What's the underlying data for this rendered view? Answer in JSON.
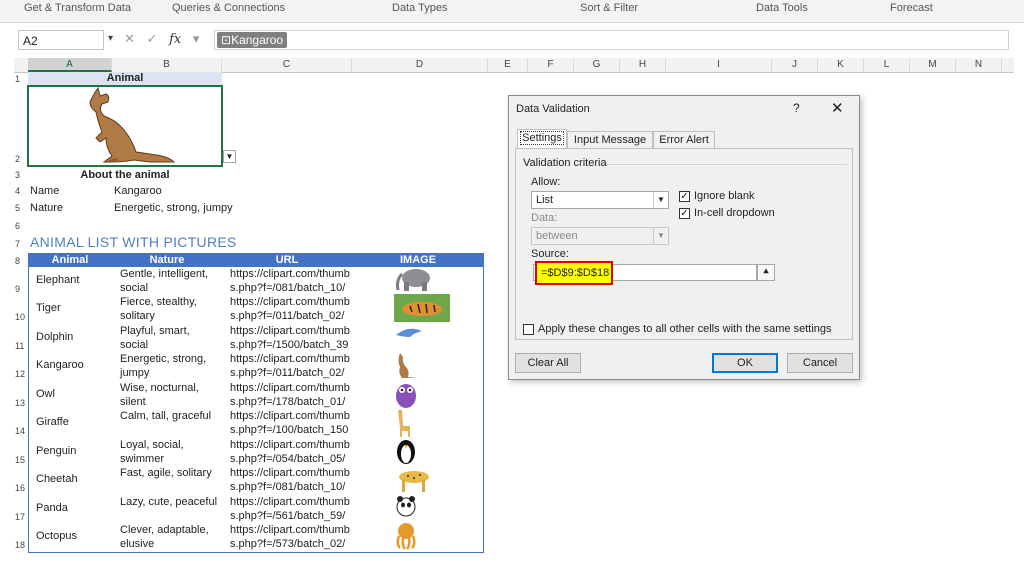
{
  "ribbon": {
    "groups": [
      "Get & Transform Data",
      "Queries & Connections",
      "Data Types",
      "Sort & Filter",
      "Data Tools",
      "Forecast"
    ]
  },
  "formula_bar": {
    "name_box": "A2",
    "cancel_glyph": "✕",
    "enter_glyph": "✓",
    "fx_label": "fx",
    "content": "Kangaroo"
  },
  "columns": [
    "A",
    "B",
    "C",
    "D",
    "E",
    "F",
    "G",
    "H",
    "I",
    "J",
    "K",
    "L",
    "M",
    "N"
  ],
  "rows": [
    "1",
    "2",
    "3",
    "4",
    "5",
    "6",
    "7",
    "8",
    "9",
    "10",
    "11",
    "12",
    "13",
    "14",
    "15",
    "16",
    "17",
    "18"
  ],
  "card": {
    "title": "Animal",
    "about": "About the animal",
    "name_label": "Name",
    "name_value": "Kangaroo",
    "nature_label": "Nature",
    "nature_value": "Energetic, strong, jumpy"
  },
  "list_title": "ANIMAL LIST WITH PICTURES",
  "table": {
    "headers": [
      "Animal",
      "Nature",
      "URL",
      "IMAGE"
    ],
    "rows": [
      {
        "animal": "Elephant",
        "nature": "Gentle, intelligent, social",
        "url": "https://clipart.com/thumbs.php?f=/081/batch_10/",
        "image": "elephant"
      },
      {
        "animal": "Tiger",
        "nature": "Fierce, stealthy, solitary",
        "url": "https://clipart.com/thumbs.php?f=/011/batch_02/",
        "image": "tiger"
      },
      {
        "animal": "Dolphin",
        "nature": "Playful, smart, social",
        "url": "https://clipart.com/thumbs.php?f=/1500/batch_39",
        "image": "dolphin"
      },
      {
        "animal": "Kangaroo",
        "nature": "Energetic, strong, jumpy",
        "url": "https://clipart.com/thumbs.php?f=/011/batch_02/",
        "image": "kangaroo"
      },
      {
        "animal": "Owl",
        "nature": "Wise, nocturnal, silent",
        "url": "https://clipart.com/thumbs.php?f=/178/batch_01/",
        "image": "owl"
      },
      {
        "animal": "Giraffe",
        "nature": "Calm, tall, graceful",
        "url": "https://clipart.com/thumbs.php?f=/100/batch_150",
        "image": "giraffe"
      },
      {
        "animal": "Penguin",
        "nature": "Loyal, social, swimmer",
        "url": "https://clipart.com/thumbs.php?f=/054/batch_05/",
        "image": "penguin"
      },
      {
        "animal": "Cheetah",
        "nature": "Fast, agile, solitary",
        "url": "https://clipart.com/thumbs.php?f=/081/batch_10/",
        "image": "cheetah"
      },
      {
        "animal": "Panda",
        "nature": "Lazy, cute, peaceful",
        "url": "https://clipart.com/thumbs.php?f=/561/batch_59/",
        "image": "panda"
      },
      {
        "animal": "Octopus",
        "nature": "Clever, adaptable, elusive",
        "url": "https://clipart.com/thumbs.php?f=/573/batch_02/",
        "image": "octopus"
      }
    ]
  },
  "dialog": {
    "title": "Data Validation",
    "help": "?",
    "close": "✕",
    "tabs": [
      "Settings",
      "Input Message",
      "Error Alert"
    ],
    "active_tab": "Settings",
    "group_label": "Validation criteria",
    "allow_label": "Allow:",
    "allow_value": "List",
    "ignore_blank_label": "Ignore blank",
    "ignore_blank_checked": true,
    "in_cell_dropdown_label": "In-cell dropdown",
    "in_cell_dropdown_checked": true,
    "data_label": "Data:",
    "data_value": "between",
    "source_label": "Source:",
    "source_value": "=$D$9:$D$18",
    "apply_all_label": "Apply these changes to all other cells with the same settings",
    "apply_all_checked": false,
    "clear_all_label": "Clear All",
    "ok_label": "OK",
    "cancel_label": "Cancel"
  },
  "colors": {
    "excel_green": "#217346",
    "table_header": "#4472c4",
    "title_blue": "#4f81bd",
    "highlight_yellow": "#ffff00",
    "highlight_red": "#e00000"
  }
}
